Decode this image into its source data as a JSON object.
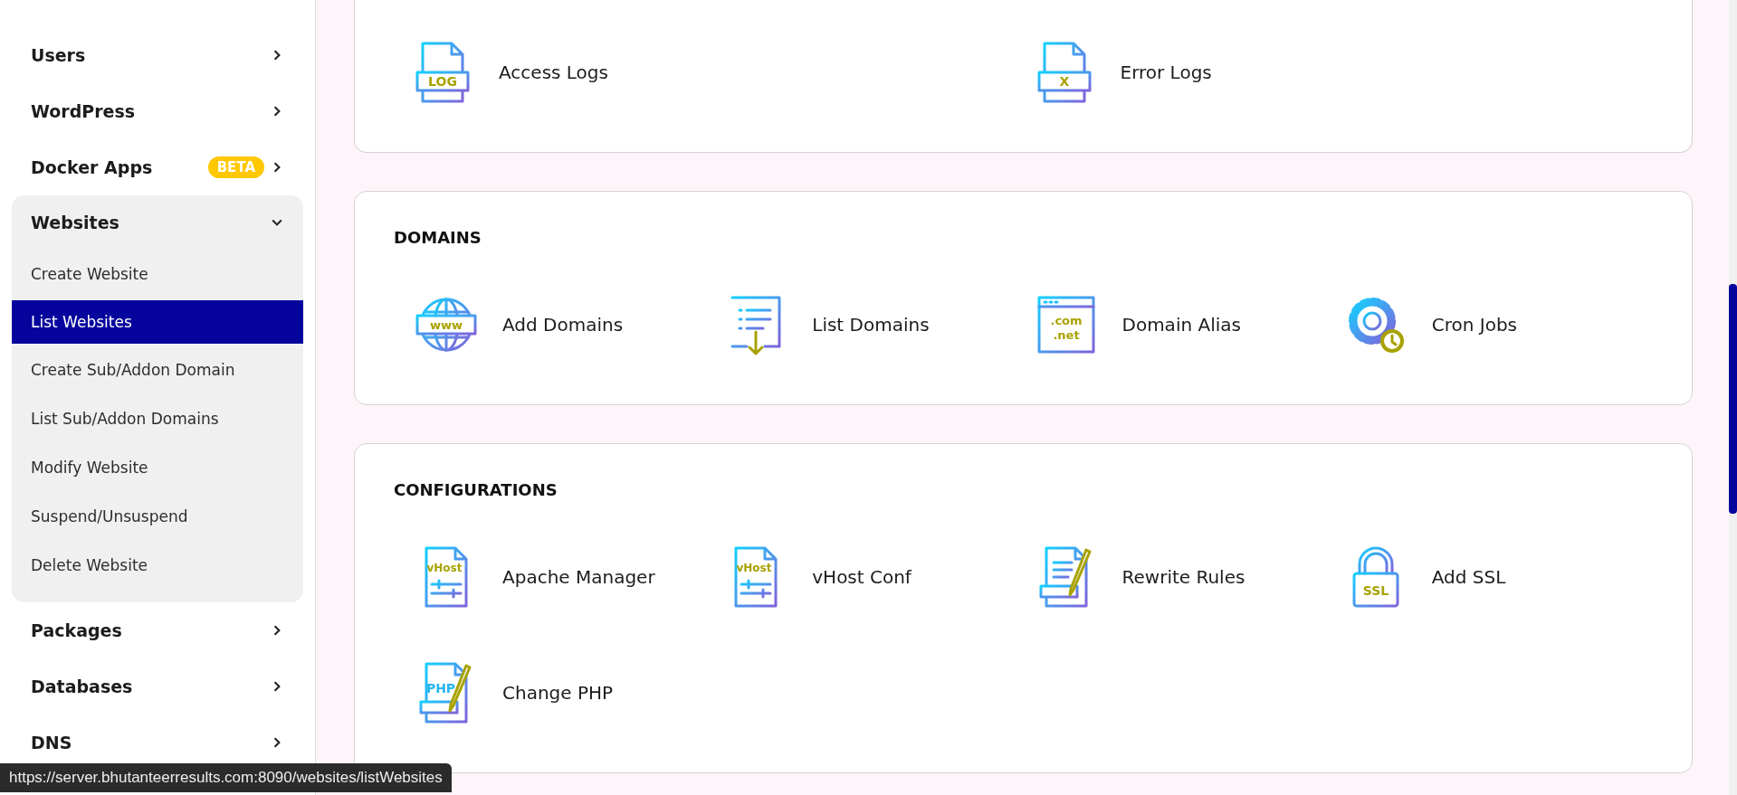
{
  "sidebar": {
    "items": [
      {
        "label": "Users",
        "kind": "link",
        "expanded": false
      },
      {
        "label": "WordPress",
        "kind": "link",
        "expanded": false
      },
      {
        "label": "Docker Apps",
        "kind": "link",
        "expanded": false,
        "badge": "BETA"
      },
      {
        "label": "Websites",
        "kind": "group",
        "expanded": true,
        "children": [
          {
            "label": "Create Website",
            "selected": false
          },
          {
            "label": "List Websites",
            "selected": true
          },
          {
            "label": "Create Sub/Addon Domain",
            "selected": false
          },
          {
            "label": "List Sub/Addon Domains",
            "selected": false
          },
          {
            "label": "Modify Website",
            "selected": false
          },
          {
            "label": "Suspend/Unsuspend",
            "selected": false
          },
          {
            "label": "Delete Website",
            "selected": false
          }
        ]
      },
      {
        "label": "Packages",
        "kind": "link",
        "expanded": false
      },
      {
        "label": "Databases",
        "kind": "link",
        "expanded": false
      },
      {
        "label": "DNS",
        "kind": "link",
        "expanded": false
      }
    ]
  },
  "sections": [
    {
      "items": [
        {
          "label": "Access Logs",
          "kind": "file",
          "badge": [
            "LOG"
          ]
        },
        {
          "label": "Error Logs",
          "kind": "file",
          "badge": [
            "X"
          ]
        }
      ]
    },
    {
      "title": "DOMAINS",
      "items": [
        {
          "label": "Add Domains",
          "kind": "globe",
          "badge": [
            "www"
          ]
        },
        {
          "label": "List Domains",
          "kind": "list"
        },
        {
          "label": "Domain Alias",
          "kind": "browser",
          "badge": [
            ".com",
            ".net"
          ]
        },
        {
          "label": "Cron Jobs",
          "kind": "gear"
        }
      ]
    },
    {
      "title": "CONFIGURATIONS",
      "items": [
        {
          "label": "Apache Manager",
          "kind": "vhost",
          "badge": [
            "vHost"
          ]
        },
        {
          "label": "vHost Conf",
          "kind": "vhost",
          "badge": [
            "vHost"
          ]
        },
        {
          "label": "Rewrite Rules",
          "kind": "edit"
        },
        {
          "label": "Add SSL",
          "kind": "lock",
          "badge": [
            "SSL"
          ]
        },
        {
          "label": "Change PHP",
          "kind": "edit",
          "badge": [
            "PHP"
          ]
        }
      ]
    }
  ],
  "status_bar": {
    "url": "https://server.bhutanteerresults.com:8090/websites/listWebsites"
  }
}
